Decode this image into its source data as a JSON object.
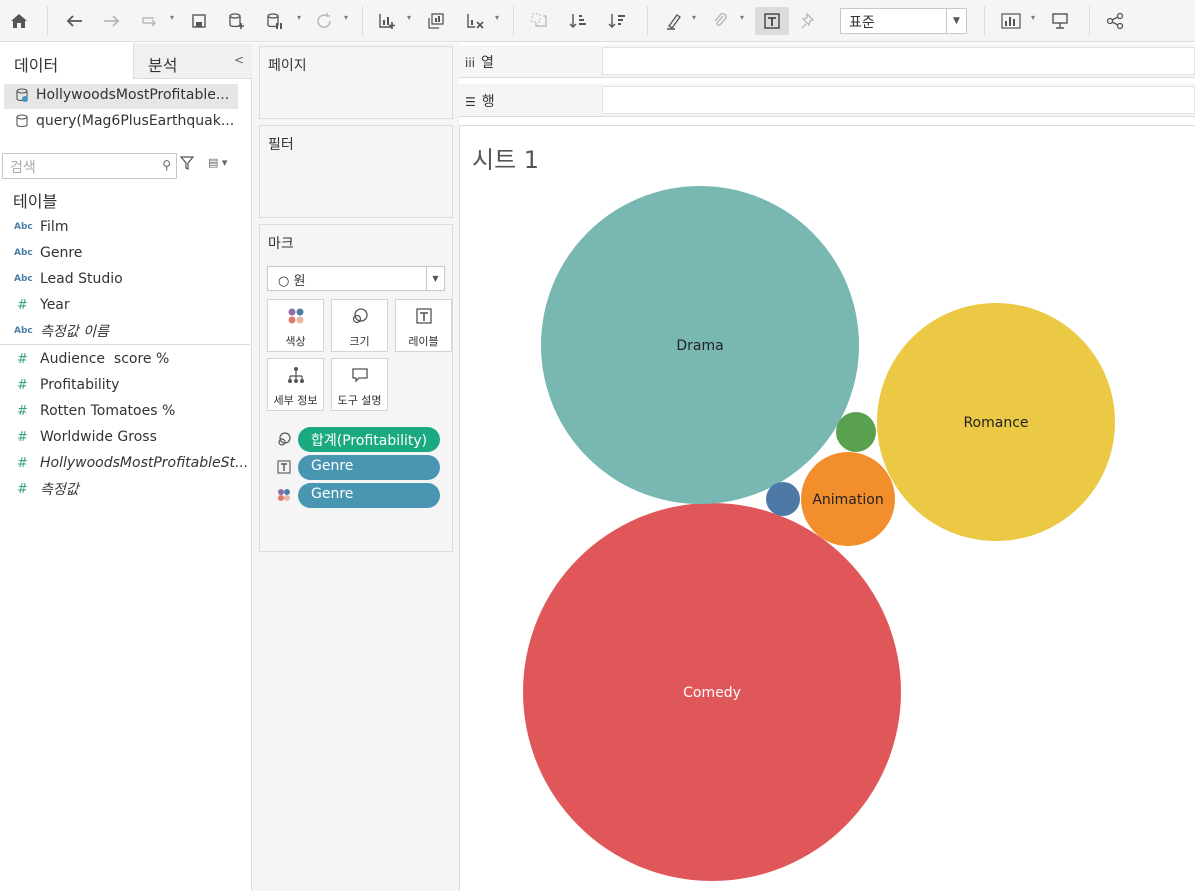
{
  "toolbar": {
    "icons": [
      "home-icon",
      "undo-icon",
      "redo-icon",
      "replay-icon",
      "save-icon",
      "new-datasource-icon",
      "pause-update-icon",
      "refresh-icon",
      "new-worksheet-icon",
      "duplicate-sheet-icon",
      "clear-sheet-icon",
      "swap-icon",
      "sort-ascending-icon",
      "sort-descending-icon",
      "highlight-icon",
      "group-icon",
      "show-labels-icon",
      "fix-axes-icon",
      "show-me-icon",
      "presentation-icon",
      "share-icon"
    ],
    "fit_value": "표준"
  },
  "data_pane": {
    "tabs": {
      "data": "데이터",
      "analysis": "분석"
    },
    "datasources": [
      "HollywoodsMostProfitable...",
      "query(Mag6PlusEarthquak..."
    ],
    "search_placeholder": "검색",
    "section_title": "테이블",
    "dimensions": [
      {
        "type": "Abc",
        "name": "Film"
      },
      {
        "type": "Abc",
        "name": "Genre"
      },
      {
        "type": "Abc",
        "name": "Lead Studio"
      },
      {
        "type": "#",
        "name": "Year"
      },
      {
        "type": "Abc",
        "name": "측정값 이름"
      }
    ],
    "measures": [
      {
        "type": "#",
        "name": "Audience  score %"
      },
      {
        "type": "#",
        "name": "Profitability"
      },
      {
        "type": "#",
        "name": "Rotten Tomatoes %"
      },
      {
        "type": "#",
        "name": "Worldwide Gross"
      },
      {
        "type": "#",
        "name": "HollywoodsMostProfitableSt..."
      },
      {
        "type": "#",
        "name": "측정값"
      }
    ]
  },
  "cards": {
    "pages": "페이지",
    "filters": "필터",
    "marks": {
      "title": "마크",
      "mark_type": "원",
      "buttons": {
        "color": "색상",
        "size": "크기",
        "label": "레이블",
        "detail": "세부 정보",
        "tooltip": "도구 설명"
      },
      "pills": [
        "합계(Profitability)",
        "Genre",
        "Genre"
      ]
    }
  },
  "shelves": {
    "columns": "열",
    "rows": "행"
  },
  "sheet": {
    "title": "시트 1"
  },
  "chart_data": {
    "type": "packed-bubble",
    "size_field": "합계(Profitability)",
    "label_field": "Genre",
    "color_field": "Genre",
    "bubbles": [
      {
        "label": "Comedy",
        "color": "#e05759",
        "text_color": "#ffffff",
        "show_label": true
      },
      {
        "label": "Drama",
        "color": "#79b7b2",
        "text_color": "#222222",
        "show_label": true
      },
      {
        "label": "Romance",
        "color": "#ebc945",
        "text_color": "#222222",
        "show_label": true
      },
      {
        "label": "Animation",
        "color": "#f28e2c",
        "text_color": "#222222",
        "show_label": true
      },
      {
        "label": "",
        "color": "#59a14f",
        "show_label": false
      },
      {
        "label": "",
        "color": "#4e79a7",
        "show_label": false
      }
    ]
  }
}
